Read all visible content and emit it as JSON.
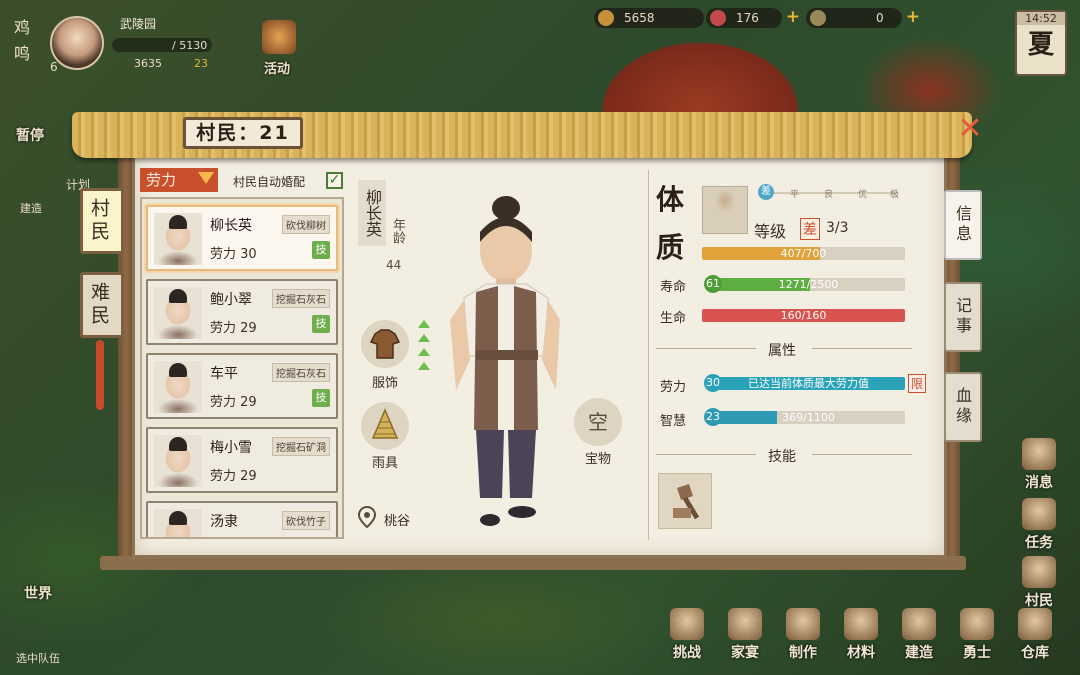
{
  "hud": {
    "village_name": "武陵园",
    "player_level": "6",
    "capacity": "/ 5130",
    "grain": "3635",
    "population": "23",
    "left_badge_1": "鸡",
    "left_badge_2": "鸣",
    "activity_label": "活动",
    "pause_label": "暂停",
    "plan_label": "计划",
    "build_label": "建造",
    "world_label": "世界",
    "team_label": "选中队伍"
  },
  "resources": {
    "copper": "5658",
    "jade": "176",
    "gold": "0"
  },
  "clock": {
    "time": "14:52",
    "season": "夏"
  },
  "panel": {
    "title": "村民：21",
    "close": "✕",
    "left_tabs": [
      "村民",
      "难民"
    ],
    "filter_label": "劳力",
    "auto_marry_label": "村民自动婚配",
    "auto_marry_check": "✓",
    "right_tabs": [
      "信息",
      "记事",
      "血缘"
    ]
  },
  "villagers": [
    {
      "name": "柳长英",
      "labor": "劳力 30",
      "job": "砍伐柳树",
      "skill": "技"
    },
    {
      "name": "鲍小翠",
      "labor": "劳力 29",
      "job": "挖掘石灰石",
      "skill": "技"
    },
    {
      "name": "车平",
      "labor": "劳力 29",
      "job": "挖掘石灰石",
      "skill": "技"
    },
    {
      "name": "梅小雪",
      "labor": "劳力 29",
      "job": "挖掘石矿洞",
      "skill": ""
    },
    {
      "name": "汤隶",
      "labor": "",
      "job": "砍伐竹子",
      "skill": ""
    }
  ],
  "detail": {
    "name": "柳长英",
    "age_label": "年龄",
    "age": "44",
    "clothing_label": "服饰",
    "raingear_label": "雨具",
    "treasure_slot": "空",
    "treasure_label": "宝物",
    "location": "桃谷",
    "constitution_label_1": "体",
    "constitution_label_2": "质",
    "grade_label": "等级",
    "grade": "差",
    "grade_count": "3/3",
    "constitution_bar": "407/700",
    "constitution_value": 0.58,
    "lifespan_label": "寿命",
    "lifespan_level": "61",
    "lifespan_bar": "1271/2500",
    "lifespan_value": 0.51,
    "health_label": "生命",
    "health_bar": "160/160",
    "health_value": 1.0,
    "attributes_title": "属性",
    "labor_label": "劳力",
    "labor_level": "30",
    "labor_text": "已达当前体质最大劳力值",
    "labor_limit": "限",
    "labor_value": 1.0,
    "wisdom_label": "智慧",
    "wisdom_level": "23",
    "wisdom_bar": "369/1100",
    "wisdom_value": 0.335,
    "skills_title": "技能",
    "grade_steps": [
      "差",
      "平",
      "良",
      "优",
      "极"
    ]
  },
  "bottom_bar": [
    "挑战",
    "家宴",
    "制作",
    "材料",
    "建造",
    "勇士",
    "仓库"
  ],
  "right_side": [
    "消息",
    "任务",
    "村民"
  ],
  "colors": {
    "accent_red": "#c9502d",
    "constitution": "#e2a23a",
    "lifespan": "#5fae43",
    "health": "#d9534f",
    "labor": "#2aa3b8",
    "wisdom": "#2e9bb3"
  }
}
